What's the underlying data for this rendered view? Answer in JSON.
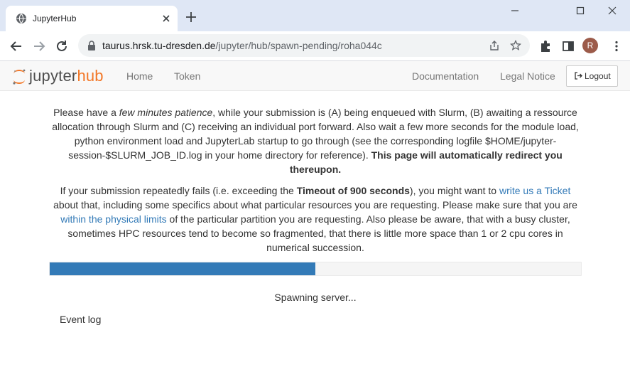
{
  "browser": {
    "tab_title": "JupyterHub",
    "url_host": "taurus.hrsk.tu-dresden.de",
    "url_path": "/jupyter/hub/spawn-pending/roha044c",
    "profile_initial": "R",
    "icons": {
      "favicon": "globe-icon",
      "tab_close": "close-icon",
      "new_tab": "plus-icon",
      "back": "arrow-left-icon",
      "forward": "arrow-right-icon",
      "reload": "reload-icon",
      "lock": "lock-icon",
      "share": "share-icon",
      "bookmark": "star-icon",
      "extensions": "puzzle-icon",
      "side_panel": "side-panel-icon",
      "menu": "kebab-menu-icon"
    }
  },
  "navbar": {
    "logo_jupyter": "jupyter",
    "logo_hub": "hub",
    "links": {
      "home": "Home",
      "token": "Token",
      "documentation": "Documentation",
      "legal": "Legal Notice"
    },
    "logout_label": "Logout"
  },
  "content": {
    "p1": {
      "t1": "Please have a ",
      "em": "few minutes patience",
      "t2": ", while your submission is (A) being enqueued with Slurm, (B) awaiting a ressource allocation through Slurm and (C) receiving an individual port forward. Also wait a few more seconds for the module load, python environment load and JupyterLab startup to go through (see the corresponding logfile $HOME/jupyter-session-$SLURM_JOB_ID.log in your home directory for reference). ",
      "bold": "This page will automatically redirect you thereupon."
    },
    "p2": {
      "t1": "If your submission repeatedly fails (i.e. exceeding the ",
      "bold": "Timeout of 900 seconds",
      "t2": "), you might want to ",
      "link1": "write us a Ticket",
      "t3": " about that, including some specifics about what particular resources you are requesting. Please make sure that you are ",
      "link2": "within the physical limits",
      "t4": " of the particular partition you are requesting. Also please be aware, that with a busy cluster, sometimes HPC resources tend to become so fragmented, that there is little more space than 1 or 2 cpu cores in numerical succession."
    },
    "progress_fraction": 0.5,
    "status": "Spawning server...",
    "event_log": "Event log"
  },
  "colors": {
    "progress": "#337ab7",
    "link": "#337ab7",
    "accent": "#f37726",
    "chrome": "#dfe7f5"
  }
}
